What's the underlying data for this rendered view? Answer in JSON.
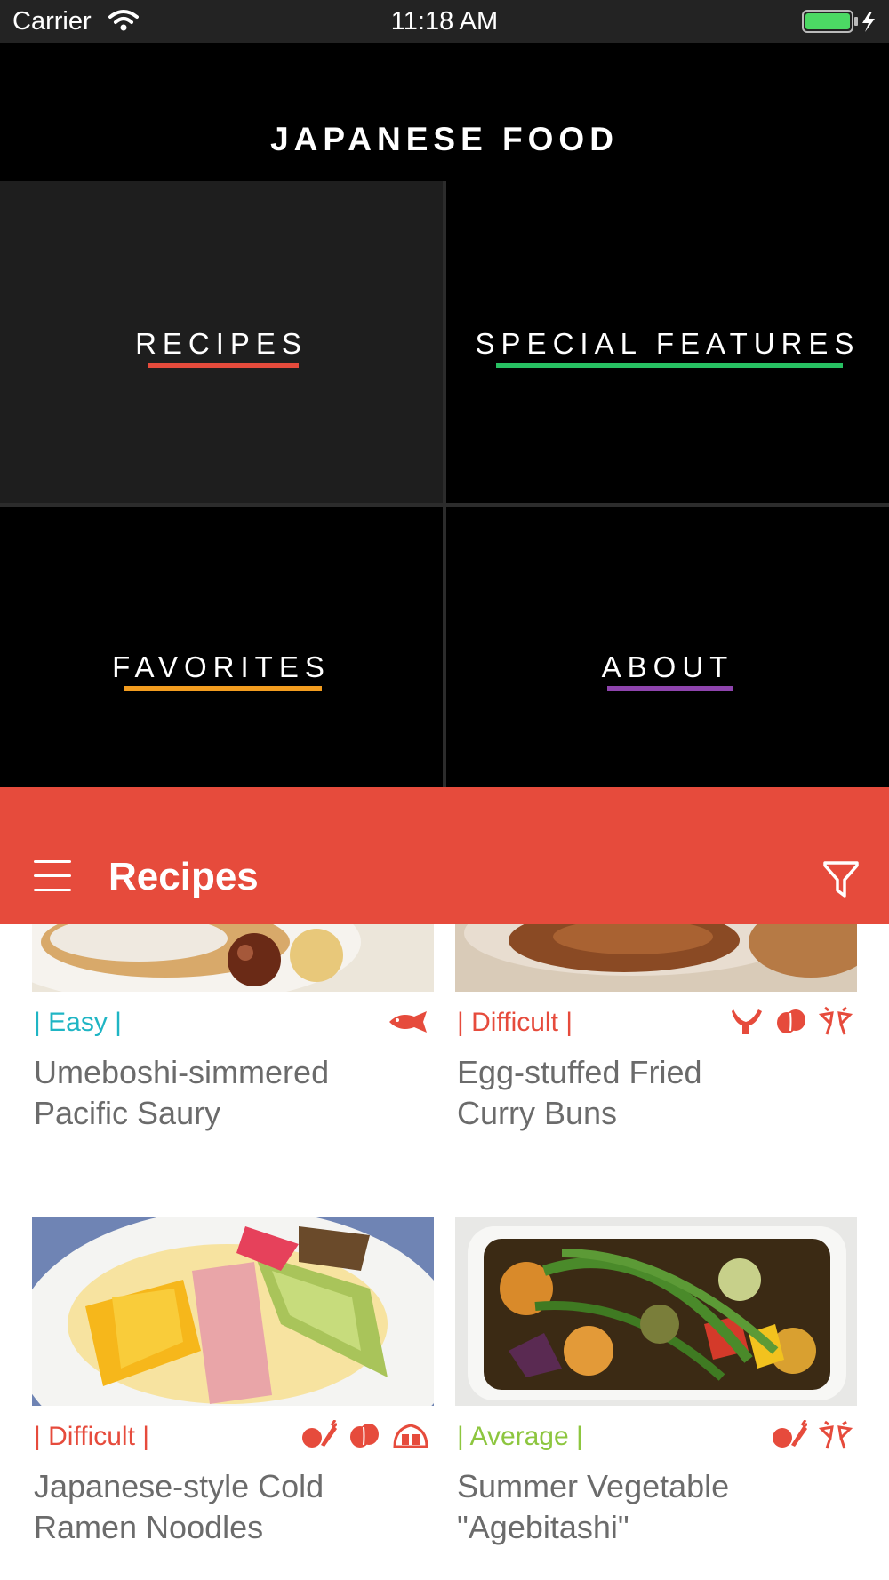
{
  "status_bar": {
    "carrier": "Carrier",
    "time": "11:18 AM"
  },
  "app": {
    "title": "JAPANESE FOOD"
  },
  "menu": {
    "items": [
      {
        "label": "RECIPES",
        "underline_color": "#e64b3c"
      },
      {
        "label": "SPECIAL FEATURES",
        "underline_color": "#27c062"
      },
      {
        "label": "FAVORITES",
        "underline_color": "#f29c1f"
      },
      {
        "label": "ABOUT",
        "underline_color": "#8e44ad"
      }
    ]
  },
  "nav": {
    "title": "Recipes",
    "menu_icon": "hamburger-icon",
    "filter_icon": "filter-icon",
    "color": "#e64b3c"
  },
  "recipes": [
    {
      "difficulty": "| Easy |",
      "difficulty_color": "#1fb5c4",
      "title_line1": "Umeboshi-simmered",
      "title_line2": "Pacific Saury",
      "icons": [
        "fish-icon"
      ]
    },
    {
      "difficulty": "| Difficult |",
      "difficulty_color": "#e64b3c",
      "title_line1": "Egg-stuffed Fried",
      "title_line2": "Curry Buns",
      "icons": [
        "chicken-icon",
        "bean-icon",
        "party-glasses-icon"
      ]
    },
    {
      "difficulty": "| Difficult |",
      "difficulty_color": "#e64b3c",
      "title_line1": "Japanese-style Cold",
      "title_line2": "Ramen Noodles",
      "icons": [
        "vegetables-icon",
        "bean-icon",
        "bento-icon"
      ]
    },
    {
      "difficulty": "| Average |",
      "difficulty_color": "#8dc63f",
      "title_line1": "Summer Vegetable",
      "title_line2": "\"Agebitashi\"",
      "icons": [
        "vegetables-icon",
        "party-glasses-icon"
      ]
    }
  ]
}
